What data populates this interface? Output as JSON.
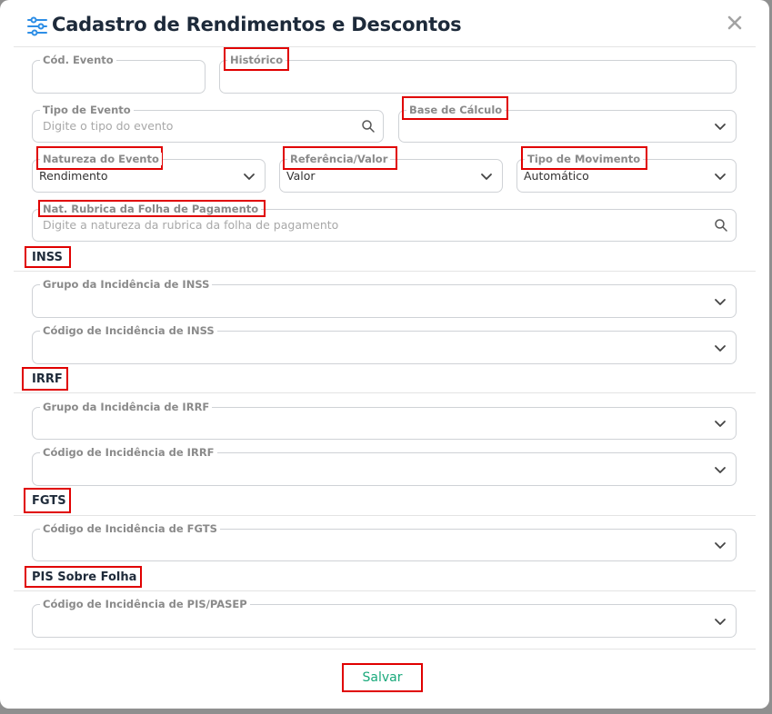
{
  "title": "Cadastro de Rendimentos e Descontos",
  "icons": {
    "title": "sliders-icon",
    "close": "close-icon",
    "search": "search-icon",
    "dropdown": "chevron-down-icon"
  },
  "colors": {
    "accent": "#2d8ee6",
    "save": "#19a97b",
    "highlight": "#e00000"
  },
  "fields": {
    "cod_evento": {
      "label": "Cód. Evento",
      "value": ""
    },
    "historico": {
      "label": "Histórico",
      "value": ""
    },
    "tipo_evento": {
      "label": "Tipo de Evento",
      "placeholder": "Digite o tipo do evento"
    },
    "base_calculo": {
      "label": "Base de Cálculo",
      "value": ""
    },
    "natureza_evento": {
      "label": "Natureza do Evento",
      "value": "Rendimento"
    },
    "referencia_valor": {
      "label": "Referência/Valor",
      "value": "Valor"
    },
    "tipo_movimento": {
      "label": "Tipo de Movimento",
      "value": "Automático"
    },
    "nat_rubrica": {
      "label": "Nat. Rubrica da Folha de Pagamento",
      "placeholder": "Digite a natureza da rubrica da folha de pagamento"
    }
  },
  "sections": {
    "inss": {
      "title": "INSS",
      "grupo_label": "Grupo da Incidência de INSS",
      "codigo_label": "Código de Incidência de INSS"
    },
    "irrf": {
      "title": "IRRF",
      "grupo_label": "Grupo da Incidência de IRRF",
      "codigo_label": "Código de Incidência de IRRF"
    },
    "fgts": {
      "title": "FGTS",
      "codigo_label": "Código de Incidência de FGTS"
    },
    "pis": {
      "title": "PIS Sobre Folha",
      "codigo_label": "Código de Incidência de PIS/PASEP"
    }
  },
  "footer": {
    "save_label": "Salvar"
  }
}
